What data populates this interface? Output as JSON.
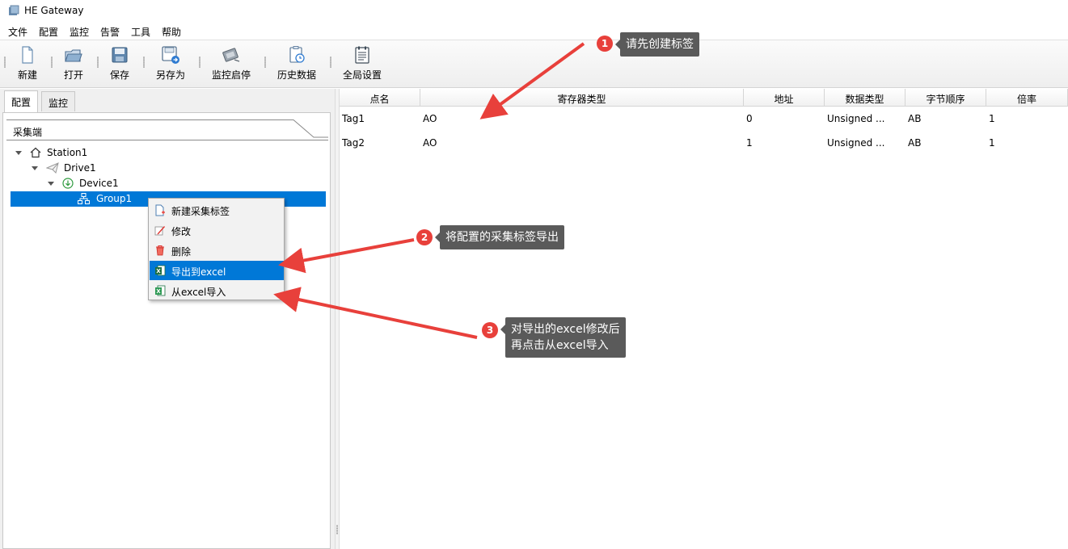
{
  "window": {
    "title": "HE Gateway"
  },
  "menu": [
    "文件",
    "配置",
    "监控",
    "告警",
    "工具",
    "帮助"
  ],
  "toolbar": {
    "new": "新建",
    "open": "打开",
    "save": "保存",
    "save_as": "另存为",
    "monitor_start_stop": "监控启停",
    "history": "历史数据",
    "global_settings": "全局设置"
  },
  "left_tabs": [
    "配置",
    "监控"
  ],
  "section_header": "采集端",
  "tree": {
    "station": "Station1",
    "drive": "Drive1",
    "device": "Device1",
    "group": "Group1"
  },
  "table": {
    "columns": [
      "点名",
      "寄存器类型",
      "地址",
      "数据类型",
      "字节顺序",
      "倍率"
    ],
    "rows": [
      [
        "Tag1",
        "AO",
        "0",
        "Unsigned ...",
        "AB",
        "1"
      ],
      [
        "Tag2",
        "AO",
        "1",
        "Unsigned ...",
        "AB",
        "1"
      ]
    ]
  },
  "context_menu": {
    "new_tag": "新建采集标签",
    "modify": "修改",
    "delete": "删除",
    "export_excel": "导出到excel",
    "import_excel": "从excel导入"
  },
  "annotations": [
    {
      "num": "1",
      "text": "请先创建标签"
    },
    {
      "num": "2",
      "text": "将配置的采集标签导出"
    },
    {
      "num": "3",
      "text_line1": "对导出的excel修改后",
      "text_line2": "再点击从excel导入"
    }
  ],
  "colors": {
    "selection": "#0078d7",
    "annotation_red": "#e8403b",
    "callout_gray": "#5a5a5a"
  }
}
